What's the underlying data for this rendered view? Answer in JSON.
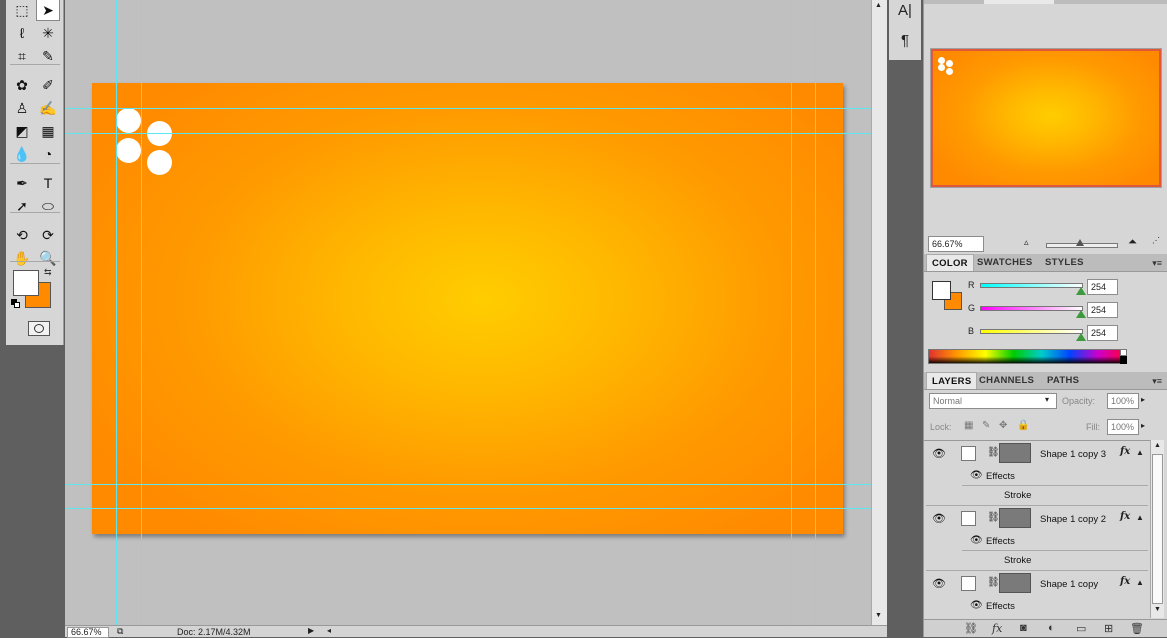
{
  "tools": [
    {
      "name": "marquee-tool-icon",
      "glyph": "⬚",
      "x": 0,
      "y": 0
    },
    {
      "name": "move-tool-icon",
      "glyph": "➤",
      "x": 1,
      "y": 0,
      "selected": true
    },
    {
      "name": "lasso-tool-icon",
      "glyph": "ℓ",
      "x": 0,
      "y": 1
    },
    {
      "name": "magic-wand-tool-icon",
      "glyph": "✳",
      "x": 1,
      "y": 1
    },
    {
      "name": "crop-tool-icon",
      "glyph": "⌗",
      "x": 0,
      "y": 2
    },
    {
      "name": "eyedropper-tool-icon",
      "glyph": "✎",
      "x": 1,
      "y": 2
    },
    {
      "name": "spot-healing-tool-icon",
      "glyph": "✿",
      "x": 0,
      "y": 3
    },
    {
      "name": "brush-tool-icon",
      "glyph": "✐",
      "x": 1,
      "y": 3
    },
    {
      "name": "clone-stamp-tool-icon",
      "glyph": "♙",
      "x": 0,
      "y": 4
    },
    {
      "name": "history-brush-tool-icon",
      "glyph": "✍",
      "x": 1,
      "y": 4
    },
    {
      "name": "eraser-tool-icon",
      "glyph": "◩",
      "x": 0,
      "y": 5
    },
    {
      "name": "gradient-tool-icon",
      "glyph": "▦",
      "x": 1,
      "y": 5
    },
    {
      "name": "blur-tool-icon",
      "glyph": "💧",
      "x": 0,
      "y": 6
    },
    {
      "name": "dodge-tool-icon",
      "glyph": "◔",
      "x": 1,
      "y": 6
    },
    {
      "name": "pen-tool-icon",
      "glyph": "✒",
      "x": 0,
      "y": 7
    },
    {
      "name": "type-tool-icon",
      "glyph": "T",
      "x": 1,
      "y": 7
    },
    {
      "name": "path-selection-tool-icon",
      "glyph": "➚",
      "x": 0,
      "y": 8
    },
    {
      "name": "ellipse-tool-icon",
      "glyph": "⬭",
      "x": 1,
      "y": 8
    },
    {
      "name": "3d-rotate-tool-icon",
      "glyph": "⟲",
      "x": 0,
      "y": 9
    },
    {
      "name": "3d-orbit-tool-icon",
      "glyph": "⟳",
      "x": 1,
      "y": 9
    },
    {
      "name": "hand-tool-icon",
      "glyph": "✋",
      "x": 0,
      "y": 10
    },
    {
      "name": "zoom-tool-icon",
      "glyph": "🔍",
      "x": 1,
      "y": 10
    }
  ],
  "colors": {
    "foreground": "#ffffff",
    "background": "#ff8a00",
    "guide": "#5ee6f0",
    "nav_border": "#e0573a"
  },
  "status": {
    "zoom": "66.67%",
    "doc": "Doc: 2.17M/4.32M"
  },
  "strip": {
    "character_icon": "A|",
    "paragraph_icon": "¶"
  },
  "navigator": {
    "zoom": "66.67%"
  },
  "color_panel": {
    "tabs": [
      "COLOR",
      "SWATCHES",
      "STYLES"
    ],
    "active_tab": "COLOR",
    "channels": [
      {
        "label": "R",
        "value": "254"
      },
      {
        "label": "G",
        "value": "254"
      },
      {
        "label": "B",
        "value": "254"
      }
    ]
  },
  "layers_panel": {
    "tabs": [
      "LAYERS",
      "CHANNELS",
      "PATHS"
    ],
    "active_tab": "LAYERS",
    "blend_mode": "Normal",
    "opacity_label": "Opacity:",
    "opacity": "100%",
    "lock_label": "Lock:",
    "fill_label": "Fill:",
    "fill": "100%",
    "layers": [
      {
        "name": "Shape 1 copy 3",
        "effects_label": "Effects",
        "stroke_label": "Stroke"
      },
      {
        "name": "Shape 1 copy 2",
        "effects_label": "Effects",
        "stroke_label": "Stroke"
      },
      {
        "name": "Shape 1 copy",
        "effects_label": "Effects"
      }
    ]
  }
}
